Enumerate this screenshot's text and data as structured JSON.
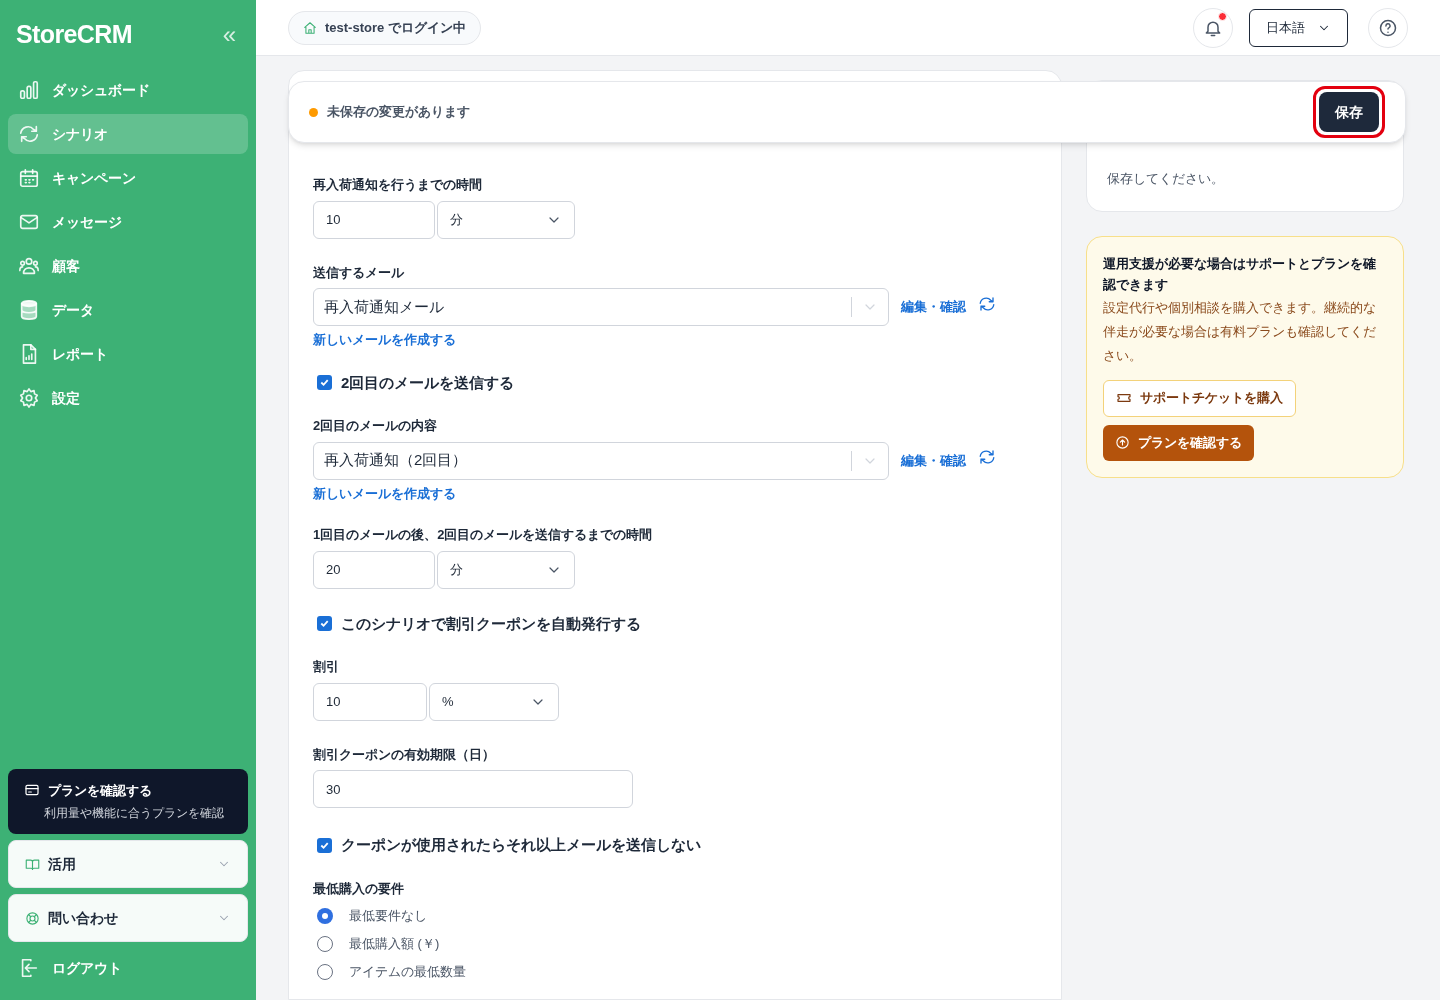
{
  "sidebar": {
    "logo": "StoreCRM",
    "collapse": "«",
    "items": [
      {
        "label": "ダッシュボード",
        "selected": false
      },
      {
        "label": "シナリオ",
        "selected": true
      },
      {
        "label": "キャンペーン",
        "selected": false
      },
      {
        "label": "メッセージ",
        "selected": false
      },
      {
        "label": "顧客",
        "selected": false
      },
      {
        "label": "データ",
        "selected": false
      },
      {
        "label": "レポート",
        "selected": false
      },
      {
        "label": "設定",
        "selected": false
      }
    ],
    "plan_card": {
      "title": "プランを確認する",
      "subtitle": "利用量や機能に合うプランを確認"
    },
    "sections": [
      {
        "label": "活用",
        "expanded": false
      },
      {
        "label": "問い合わせ",
        "expanded": false
      }
    ],
    "logout": "ログアウト"
  },
  "topbar": {
    "store": "test-store でログイン中",
    "notifications_unread": true,
    "language": "日本語"
  },
  "banner": {
    "text": "未保存の変更があります",
    "save_button": "保存"
  },
  "form": [
    {
      "kind": "number_unit",
      "label": "再入荷通知を行うまでの時間",
      "value": "10",
      "unit": "分"
    },
    {
      "kind": "email_select",
      "label": "送信するメール",
      "value": "再入荷通知メール",
      "edit_link": "編集・確認",
      "new_link": "新しいメールを作成する"
    },
    {
      "kind": "checkbox",
      "label": "2回目のメールを送信する",
      "checked": true
    },
    {
      "kind": "email_select",
      "label": "2回目のメールの内容",
      "value": "再入荷通知（2回目）",
      "edit_link": "編集・確認",
      "new_link": "新しいメールを作成する"
    },
    {
      "kind": "number_unit",
      "label": "1回目のメールの後、2回目のメールを送信するまでの時間",
      "value": "20",
      "unit": "分"
    },
    {
      "kind": "checkbox",
      "label": "このシナリオで割引クーポンを自動発行する",
      "checked": true
    },
    {
      "kind": "number_unit",
      "label": "割引",
      "value": "10",
      "unit": "%"
    },
    {
      "kind": "text",
      "label": "割引クーポンの有効期限（日）",
      "value": "30"
    },
    {
      "kind": "checkbox",
      "label": "クーポンが使用されたらそれ以上メールを送信しない",
      "checked": true
    },
    {
      "kind": "radio_group",
      "label": "最低購入の要件",
      "options": [
        {
          "label": "最低要件なし",
          "selected": true
        },
        {
          "label": "最低購入額 (￥)",
          "selected": false
        },
        {
          "label": "アイテムの最低数量",
          "selected": false
        }
      ]
    }
  ],
  "info_card": {
    "text": "保存してください。"
  },
  "support_card": {
    "title": "運用支援が必要な場合はサポートとプランを確認できます",
    "body": "設定代行や個別相談を購入できます。継続的な伴走が必要な場合は有料プランも確認してください。",
    "ticket_button": "サポートチケットを購入",
    "plan_button": "プランを確認する"
  }
}
